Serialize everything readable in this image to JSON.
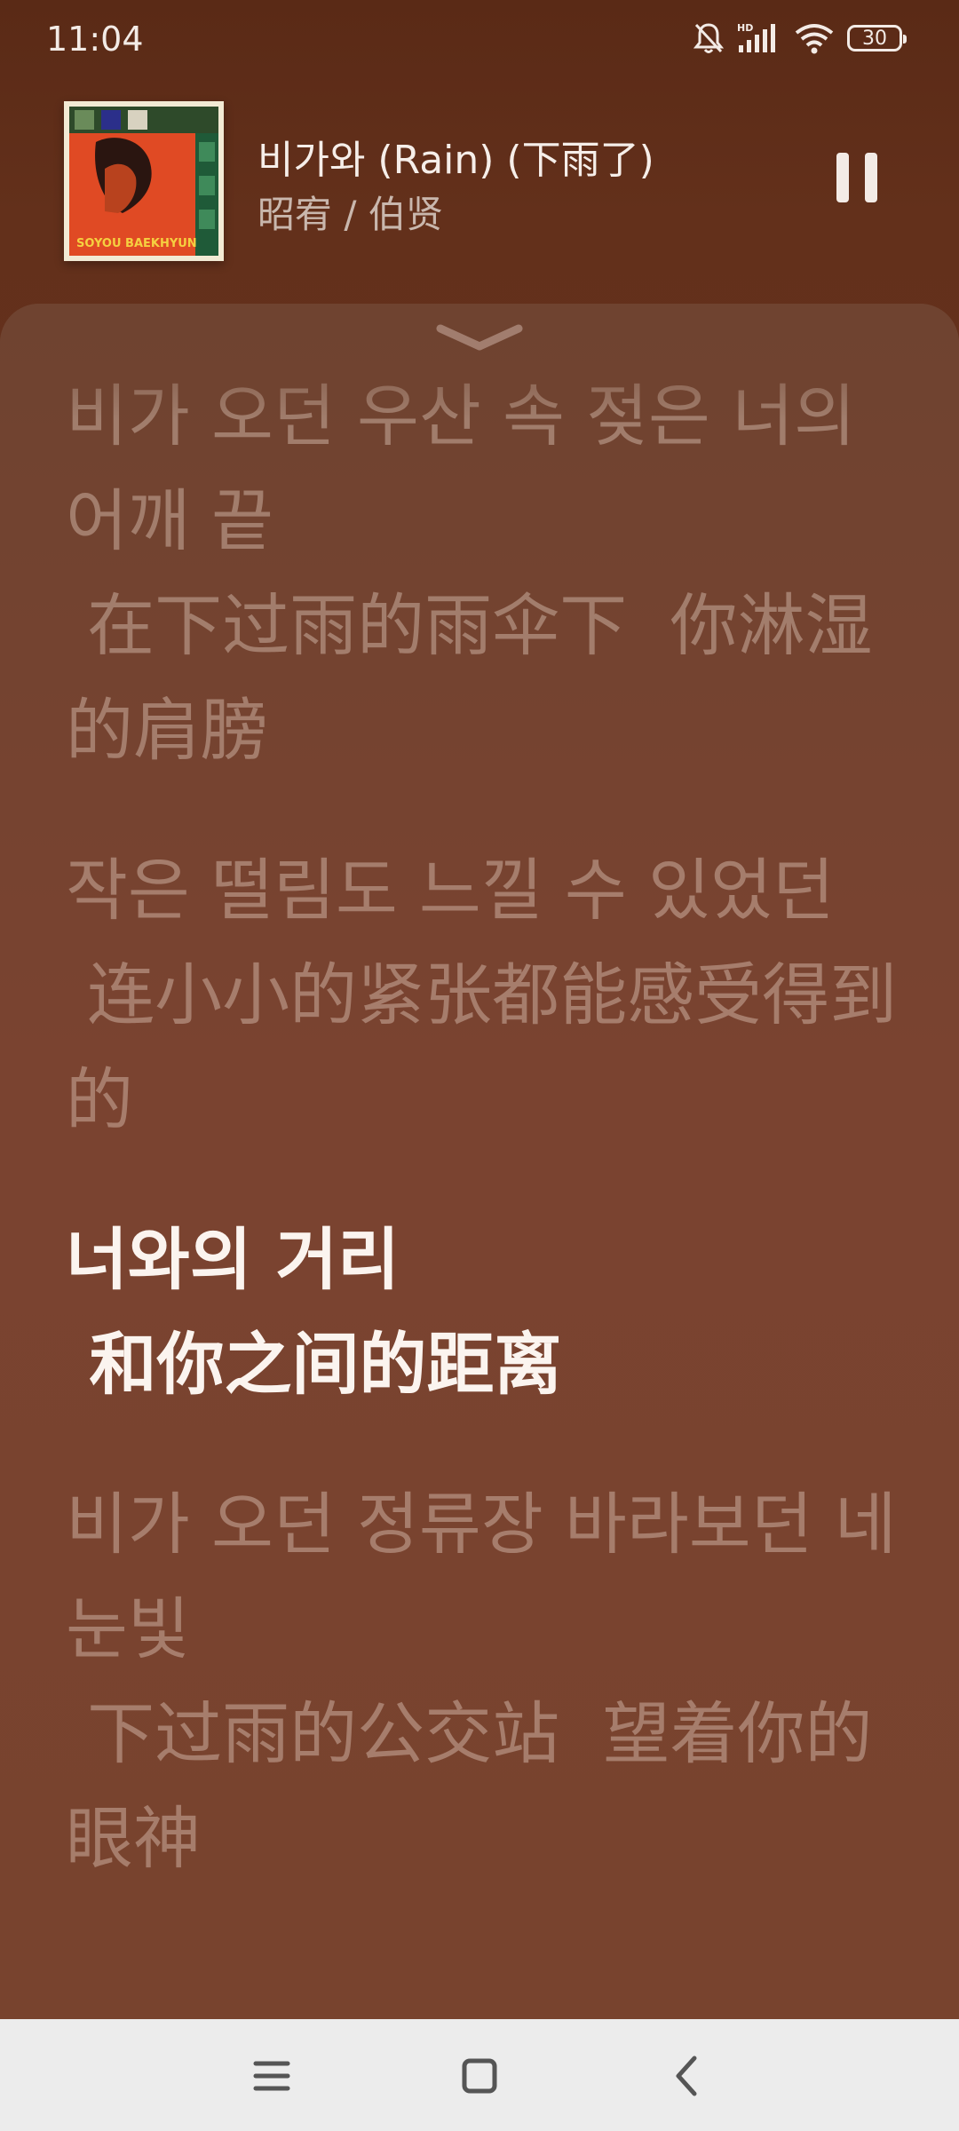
{
  "status_bar": {
    "time": "11:04",
    "battery": "30",
    "icons": [
      "bell-off-icon",
      "hd-signal-icon",
      "wifi-icon",
      "battery-icon"
    ]
  },
  "now_playing": {
    "title": "비가와 (Rain) (下雨了)",
    "artist": "昭宥  /  伯贤",
    "album_art_icon": "album-cover-icon",
    "pause_icon": "pause-icon"
  },
  "lyrics": {
    "collapse_icon": "chevron-down-icon",
    "blocks": [
      {
        "original": "비가 오던 우산 속 젖은 너의 어깨 끝",
        "translation": " 在下过雨的雨伞下  你淋湿的肩膀",
        "active": false
      },
      {
        "original": "작은 떨림도 느낄 수 있었던",
        "translation": " 连小小的紧张都能感受得到的",
        "active": false
      },
      {
        "original": "너와의 거리",
        "translation": " 和你之间的距离",
        "active": true
      },
      {
        "original": "비가 오던 정류장 바라보던 네 눈빛",
        "translation": " 下过雨的公交站  望着你的眼神",
        "active": false
      }
    ]
  },
  "nav_bar": {
    "icons": [
      "menu-icon",
      "home-icon",
      "back-icon"
    ]
  },
  "colors": {
    "background_top": "#5a2a16",
    "panel": "#78432e",
    "active_lyric": "#fbf4ef",
    "inactive_lyric": "#a57a6a",
    "nav_bar": "#ececec"
  }
}
